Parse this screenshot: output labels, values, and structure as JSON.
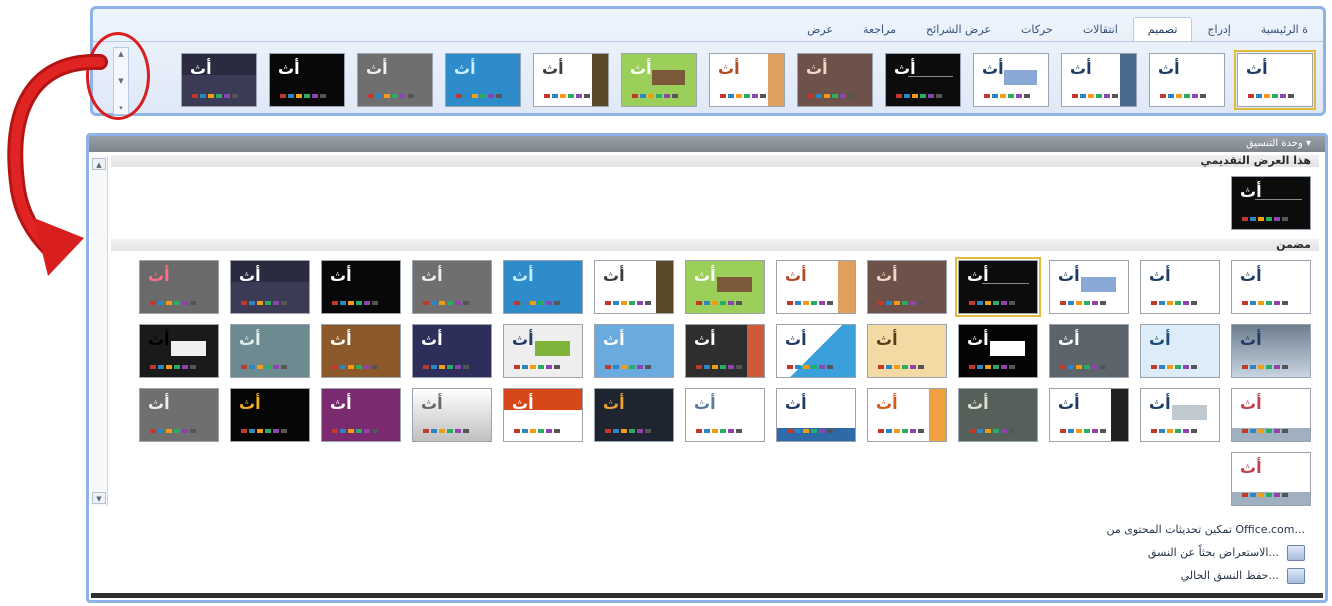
{
  "ribbon": {
    "tabs": [
      "ة الرئيسية",
      "إدراج",
      "تصميم",
      "انتقالات",
      "حركات",
      "عرض الشرائح",
      "مراجعة",
      "عرض"
    ],
    "active_tab": "تصميم"
  },
  "gallery": {
    "header_label": "وحدة التنسيق",
    "current_section": "هذا العرض التقديمي",
    "builtin_section": "مضمن",
    "thumb_glyph": "أث",
    "footer_links": [
      {
        "label": "تمكين تحديثات المحتوى من Office.com..."
      },
      {
        "label": "الاستعراض بحثاً عن النسق...",
        "icon": "browse-folder-icon"
      },
      {
        "label": "حفظ النسق الحالي...",
        "icon": "save-theme-icon"
      }
    ]
  },
  "colors": {
    "ribbon_border": "#8fb3e6",
    "highlight_circle": "#d81e1e",
    "selected_theme": "#e3b93b"
  }
}
